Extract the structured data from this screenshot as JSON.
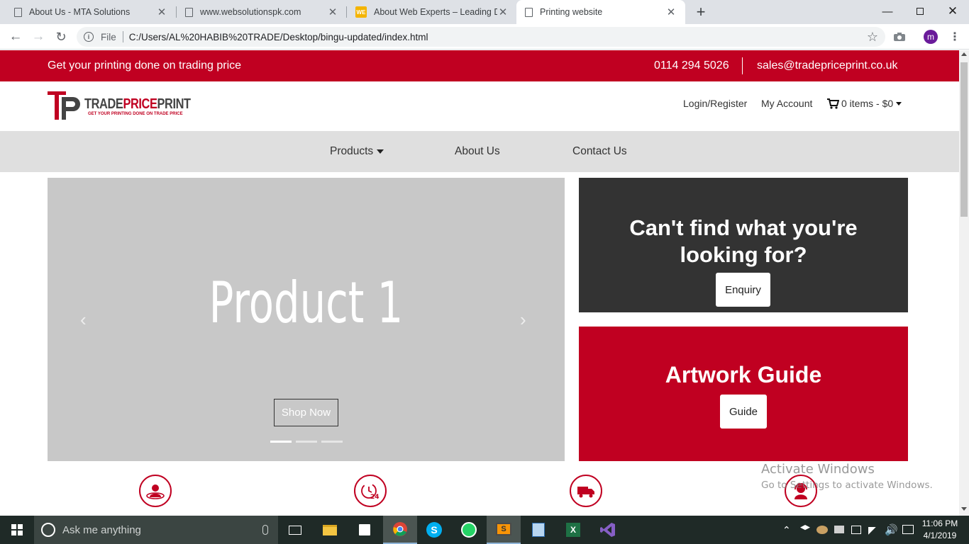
{
  "browser": {
    "tabs": [
      {
        "title": "About Us - MTA Solutions"
      },
      {
        "title": "www.websolutionspk.com"
      },
      {
        "title": "About Web Experts – Leading De"
      },
      {
        "title": "Printing website"
      }
    ],
    "url_prefix": "File",
    "url": "C:/Users/AL%20HABIB%20TRADE/Desktop/bingu-updated/index.html",
    "profile_initial": "m"
  },
  "topbar": {
    "tagline": "Get your printing done on trading price",
    "phone": "0114 294 5026",
    "email": "sales@tradepriceprint.co.uk"
  },
  "header": {
    "logo_initials": "TP",
    "logo_part1": "TRADE",
    "logo_part2": "PRICE",
    "logo_part3": "PRINT",
    "logo_tagline": "GET YOUR PRINTING DONE ON TRADE PRICE",
    "login": "Login/Register",
    "account": "My Account",
    "cart": "0 items - $0"
  },
  "nav": {
    "products": "Products",
    "about": "About Us",
    "contact": "Contact Us"
  },
  "slider": {
    "slide_title": "Product 1",
    "button": "Shop Now",
    "active_index": 0,
    "count": 3
  },
  "promo": {
    "enquiry_title": "Can't find what you're looking for?",
    "enquiry_button": "Enquiry",
    "artwork_title": "Artwork Guide",
    "artwork_button": "Guide"
  },
  "watermark": {
    "line1": "Activate Windows",
    "line2": "Go to Settings to activate Windows."
  },
  "taskbar": {
    "search_placeholder": "Ask me anything",
    "time": "11:06 PM",
    "date": "4/1/2019"
  },
  "colors": {
    "brand_red": "#c00021",
    "dark_panel": "#333333",
    "nav_bg": "#dfdfdf"
  }
}
